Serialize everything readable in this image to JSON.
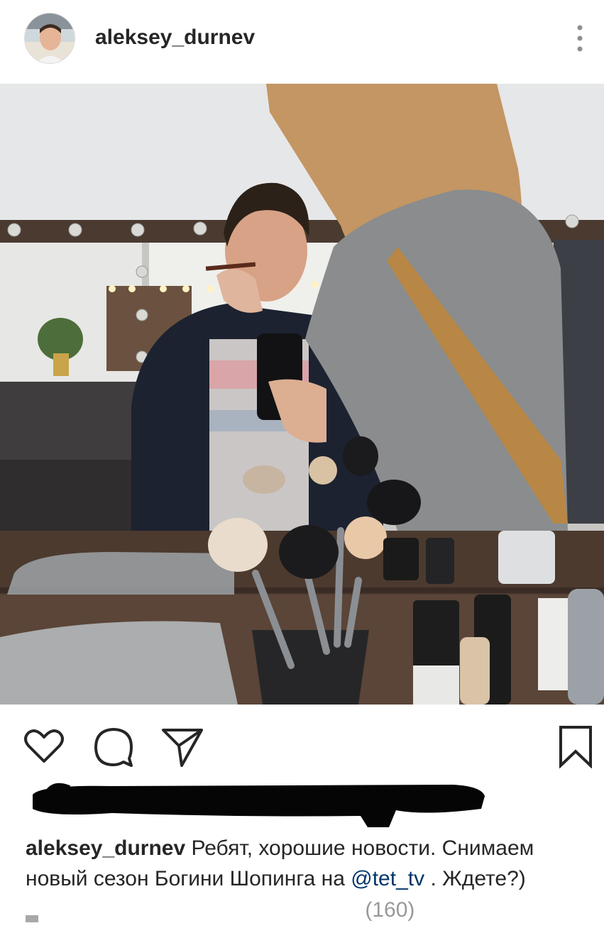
{
  "post": {
    "username": "aleksey_durnev",
    "more_icon": "more-vertical-icon",
    "image_alt": "Man having makeup applied in front of a lit makeup mirror with brushes on the table"
  },
  "actions": {
    "icons": [
      "heart-icon",
      "comment-icon",
      "share-icon",
      "bookmark-icon"
    ]
  },
  "caption": {
    "username": "aleksey_durnev",
    "text_line1": "Ребят, хорошие новости. Снимаем",
    "text_line2": "новый сезон Богини Шопинга на",
    "mention": "@tet_tv",
    "text_end": ". Ждете?)"
  },
  "comments": {
    "partial_label": "(160)"
  }
}
